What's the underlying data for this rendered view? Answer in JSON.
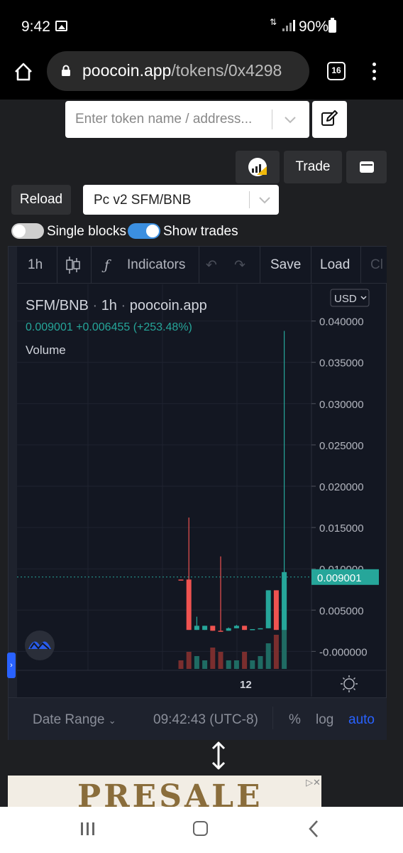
{
  "status_bar": {
    "time": "9:42",
    "battery": "90%",
    "data_icon": "4G"
  },
  "browser": {
    "url_host": "poocoin.app",
    "url_path": "/tokens/0x4298",
    "tab_count": "16"
  },
  "search": {
    "placeholder": "Enter token name / address..."
  },
  "actions": {
    "trade_label": "Trade",
    "reload_label": "Reload"
  },
  "pair_select": {
    "value": "Pc v2 SFM/BNB"
  },
  "toggles": {
    "single_blocks": {
      "label": "Single blocks",
      "on": false
    },
    "show_trades": {
      "label": "Show trades",
      "on": true
    }
  },
  "tv_toolbar": {
    "interval": "1h",
    "indicators": "Indicators",
    "save": "Save",
    "load": "Load",
    "cut": "Cl"
  },
  "legend": {
    "symbol": "SFM/BNB",
    "interval": "1h",
    "source": "poocoin.app",
    "price": "0.009001",
    "change": "+0.006455 (+253.48%)",
    "volume_label": "Volume",
    "currency": "USD"
  },
  "chart_data": {
    "type": "candlestick",
    "y_ticks": [
      "0.040000",
      "0.035000",
      "0.030000",
      "0.025000",
      "0.020000",
      "0.015000",
      "0.010000",
      "0.005000",
      "-0.000000"
    ],
    "ylim": [
      -0.001,
      0.041
    ],
    "x_ticks": [
      "12"
    ],
    "last_price": "0.009001",
    "candles": [
      {
        "o": 0.0087,
        "h": 0.0087,
        "l": 0.0086,
        "c": 0.0086,
        "color": "#ef5350"
      },
      {
        "o": 0.0087,
        "h": 0.0162,
        "l": 0.0026,
        "c": 0.0026,
        "color": "#ef5350"
      },
      {
        "o": 0.0026,
        "h": 0.0042,
        "l": 0.0026,
        "c": 0.0031,
        "color": "#26a69a"
      },
      {
        "o": 0.0026,
        "h": 0.0031,
        "l": 0.0026,
        "c": 0.0031,
        "color": "#26a69a"
      },
      {
        "o": 0.0031,
        "h": 0.0031,
        "l": 0.0025,
        "c": 0.0025,
        "color": "#ef5350"
      },
      {
        "o": 0.0025,
        "h": 0.0115,
        "l": 0.0025,
        "c": 0.0025,
        "color": "#ef5350"
      },
      {
        "o": 0.0025,
        "h": 0.0029,
        "l": 0.0025,
        "c": 0.0028,
        "color": "#26a69a"
      },
      {
        "o": 0.0028,
        "h": 0.0032,
        "l": 0.0028,
        "c": 0.0031,
        "color": "#26a69a"
      },
      {
        "o": 0.0031,
        "h": 0.0031,
        "l": 0.0026,
        "c": 0.0026,
        "color": "#ef5350"
      },
      {
        "o": 0.0026,
        "h": 0.0027,
        "l": 0.0026,
        "c": 0.0027,
        "color": "#26a69a"
      },
      {
        "o": 0.0027,
        "h": 0.0028,
        "l": 0.0027,
        "c": 0.0028,
        "color": "#26a69a"
      },
      {
        "o": 0.0028,
        "h": 0.0074,
        "l": 0.0028,
        "c": 0.0074,
        "color": "#26a69a"
      },
      {
        "o": 0.0074,
        "h": 0.0074,
        "l": 0.0026,
        "c": 0.0026,
        "color": "#ef5350"
      },
      {
        "o": 0.0026,
        "h": 0.0388,
        "l": 0.0026,
        "c": 0.0096,
        "color": "#26a69a"
      }
    ],
    "volumes": [
      0.1,
      0.2,
      0.15,
      0.1,
      0.25,
      0.2,
      0.1,
      0.1,
      0.2,
      0.1,
      0.15,
      0.3,
      0.4,
      1.0
    ]
  },
  "tv_bottom": {
    "date_range": "Date Range",
    "time": "09:42:43 (UTC-8)",
    "percent": "%",
    "log": "log",
    "auto": "auto"
  },
  "ad": {
    "text": "PRESALE"
  }
}
